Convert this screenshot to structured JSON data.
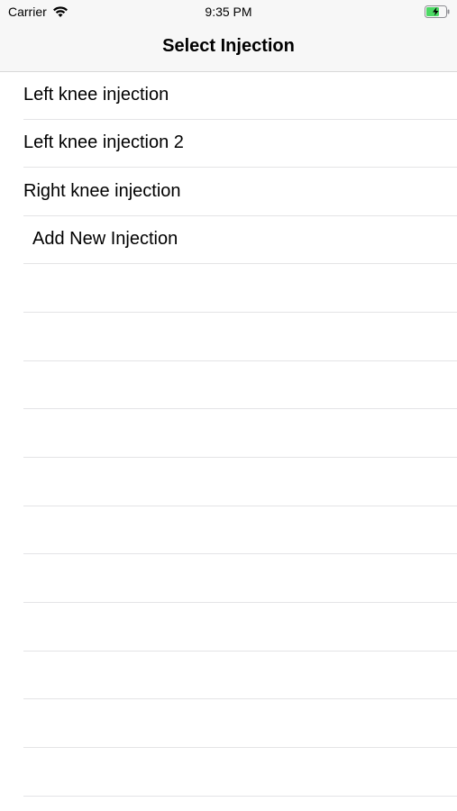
{
  "status_bar": {
    "carrier": "Carrier",
    "time": "9:35 PM",
    "battery_color": "#4cd964"
  },
  "nav": {
    "title": "Select Injection"
  },
  "injections": [
    {
      "label": "Left knee injection"
    },
    {
      "label": "Left knee injection 2"
    },
    {
      "label": "Right knee injection"
    }
  ],
  "add_new": {
    "label": "Add New Injection"
  }
}
